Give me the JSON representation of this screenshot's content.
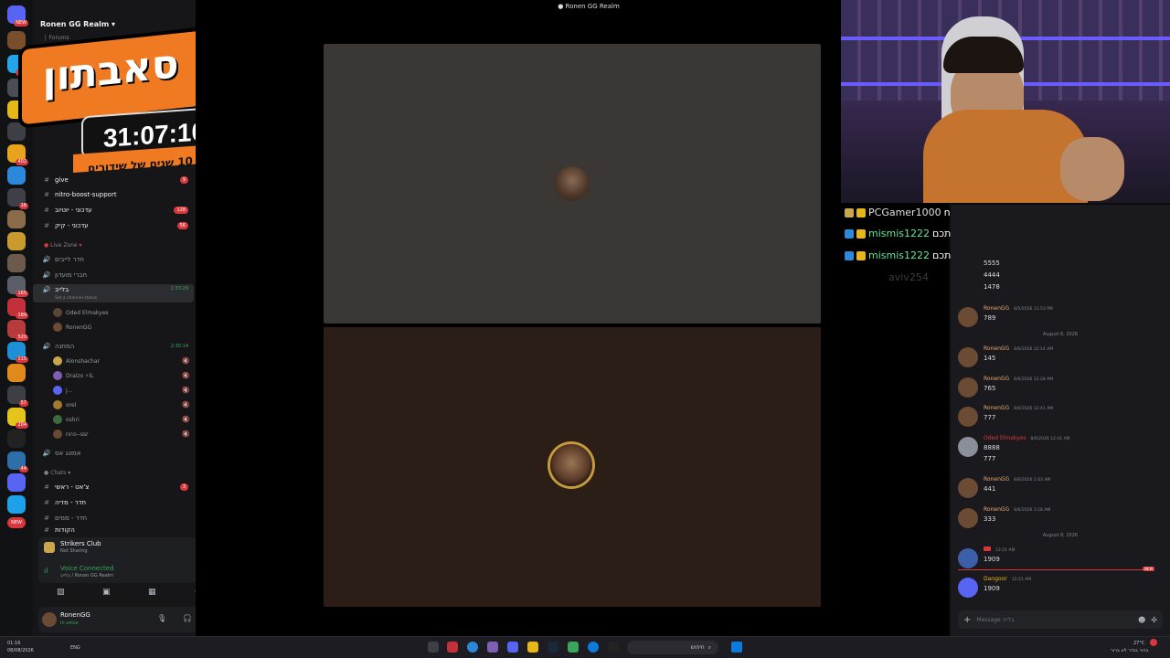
{
  "window": {
    "title": "Ronen GG Realm"
  },
  "overlay": {
    "title": "סאבתון",
    "timer": "31:07:10",
    "subtitle": "חוגגים 10 שנים של שידורים"
  },
  "server_rail": {
    "top_badge": "NEW",
    "badges": [
      "531",
      "402",
      "18",
      "165",
      "189",
      "520",
      "115",
      "57",
      "204",
      "44",
      "NEW"
    ]
  },
  "sidebar": {
    "server_name": "Ronen GG Realm",
    "forums_label": "Forums",
    "live_zone_label": "Live Zone",
    "chats_label": "Chats",
    "channels_top": [
      {
        "name": "give",
        "count": "9"
      },
      {
        "name": "nitro-boost-support",
        "count": ""
      },
      {
        "name": "עדכוני - יוטיוב",
        "count": "128"
      },
      {
        "name": "עדכוני - קיק",
        "count": "56"
      }
    ],
    "voice_rooms": [
      {
        "name": "חדר לייבים"
      },
      {
        "name": "חברי מועדון"
      }
    ],
    "active_room": {
      "name": "בלייב",
      "time": "2:33:29",
      "status": "Set a channel status"
    },
    "active_users": [
      "Oded Elmakyes",
      "RonenGG"
    ],
    "gift_room": {
      "name": "המתנה",
      "time": "2:30:14"
    },
    "gift_users": [
      "Alonshachar",
      "Draizo ⚡IL",
      "j...",
      "orel",
      "oshri",
      "פחח--ssr"
    ],
    "other_room": {
      "name": "אמונג אס"
    },
    "chat_channels": [
      {
        "name": "צ'אט - ראשי",
        "count": "3"
      },
      {
        "name": "חדר - מדיה",
        "count": ""
      },
      {
        "name": "חדר - ממים",
        "count": ""
      },
      {
        "name": "הקודות",
        "count": ""
      }
    ]
  },
  "status_panel": {
    "activity_name": "Strikers Club",
    "activity_state": "Not Sharing",
    "voice_status": "Voice Connected",
    "voice_location": "בלייב / Ronen GG Realm"
  },
  "user_panel": {
    "username": "RonenGG",
    "status": "In voice"
  },
  "overlay_chat": [
    {
      "user": "PCGamer1000",
      "text": "nnnnnnnnnn"
    },
    {
      "user": "mismis1222",
      "text": "אני ולוגי לוקחים אותכם"
    },
    {
      "user": "mismis1222",
      "text": "אני ולוגי לוקחים אותכם"
    },
    {
      "user": "aviv254",
      "text": ""
    }
  ],
  "chat": {
    "top_partial": [
      "5555",
      "4444",
      "1478"
    ],
    "messages": [
      {
        "user": "RonenGG",
        "time": "8/5/2026 11:53 PM",
        "lines": [
          "789"
        ]
      },
      {
        "divider": "August 6, 2026"
      },
      {
        "user": "RonenGG",
        "time": "8/6/2026 12:14 AM",
        "lines": [
          "145"
        ]
      },
      {
        "user": "RonenGG",
        "time": "8/6/2026 12:28 AM",
        "lines": [
          "765"
        ]
      },
      {
        "user": "RonenGG",
        "time": "8/6/2026 12:41 AM",
        "lines": [
          "777"
        ]
      },
      {
        "user": "Oded Elmakyes",
        "time": "8/6/2026 12:41 AM",
        "lines": [
          "8888",
          "777"
        ]
      },
      {
        "user": "RonenGG",
        "time": "8/6/2026 1:03 AM",
        "lines": [
          "441"
        ]
      },
      {
        "user": "RonenGG",
        "time": "8/6/2026 1:18 AM",
        "lines": [
          "333"
        ]
      },
      {
        "divider": "August 8, 2026"
      },
      {
        "user": "",
        "time": "12:21 AM",
        "lines": [
          "1909"
        ]
      },
      {
        "user": "Dangoor",
        "time": "12:21 AM",
        "lines": [
          "1909"
        ]
      }
    ],
    "new_label": "NEW",
    "input_placeholder": "Message בלייב"
  },
  "taskbar": {
    "time": "01:16",
    "date": "08/08/2026",
    "lang": "ENG",
    "search": "חיפוש",
    "weather": "27°C",
    "weather_desc": "בהיר בגדר לא ברור"
  },
  "colors": {
    "accent": "#5865f2",
    "live": "#3ba55c",
    "alert": "#da373c",
    "overlay_orange": "#f07a22"
  }
}
